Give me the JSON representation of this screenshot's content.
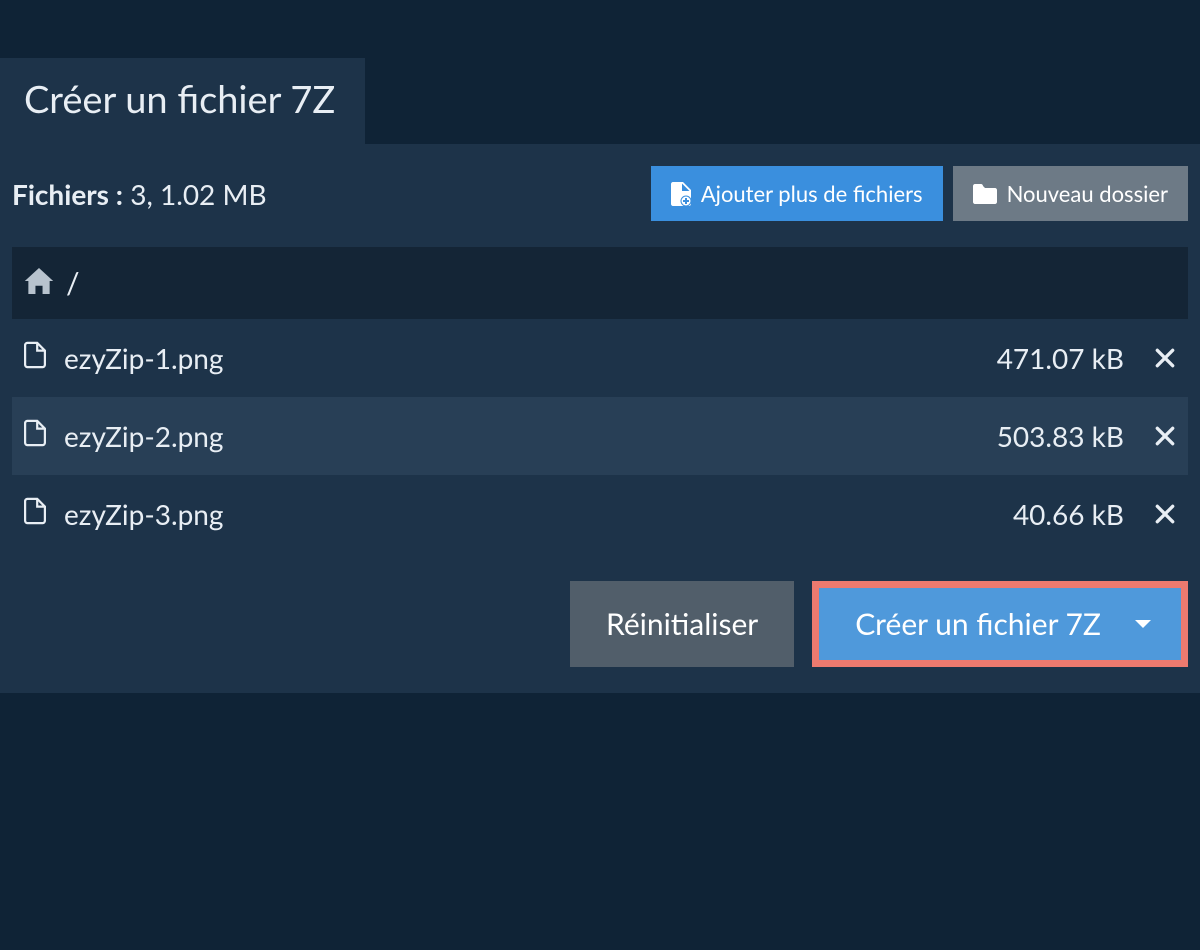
{
  "tab": {
    "title": "Créer un fichier 7Z"
  },
  "summary": {
    "label": "Fichiers :",
    "count": "3",
    "size": "1.02 MB"
  },
  "buttons": {
    "add_files": "Ajouter plus de fichiers",
    "new_folder": "Nouveau dossier",
    "reset": "Réinitialiser",
    "create": "Créer un fichier 7Z"
  },
  "breadcrumb": {
    "separator": "/"
  },
  "files": [
    {
      "name": "ezyZip-1.png",
      "size": "471.07 kB"
    },
    {
      "name": "ezyZip-2.png",
      "size": "503.83 kB"
    },
    {
      "name": "ezyZip-3.png",
      "size": "40.66 kB"
    }
  ]
}
